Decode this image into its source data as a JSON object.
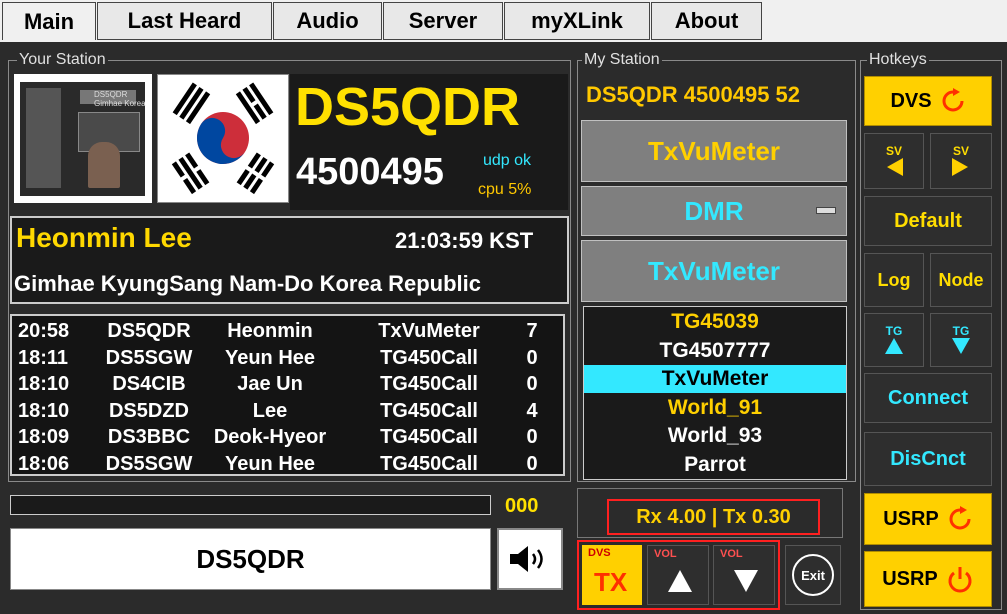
{
  "tabs": [
    {
      "label": "Main"
    },
    {
      "label": "Last Heard"
    },
    {
      "label": "Audio"
    },
    {
      "label": "Server"
    },
    {
      "label": "myXLink"
    },
    {
      "label": "About"
    }
  ],
  "your_station": {
    "group_label": "Your Station",
    "photo_caption": "DS5QDR Gimhae Korea",
    "callsign": "DS5QDR",
    "dmr_id": "4500495",
    "udp_status": "udp ok",
    "cpu": "cpu  5%",
    "name": "Heonmin Lee",
    "time": "21:03:59 KST",
    "location": "Gimhae KyungSang Nam-Do Korea Republic"
  },
  "last_heard": [
    {
      "time": "20:58",
      "call": "DS5QDR",
      "name": "Heonmin",
      "tg": "TxVuMeter",
      "dur": "7"
    },
    {
      "time": "18:11",
      "call": "DS5SGW",
      "name": "Yeun Hee",
      "tg": "TG450Call",
      "dur": "0"
    },
    {
      "time": "18:10",
      "call": "DS4CIB",
      "name": "Jae Un",
      "tg": "TG450Call",
      "dur": "0"
    },
    {
      "time": "18:10",
      "call": "DS5DZD",
      "name": "Lee",
      "tg": "TG450Call",
      "dur": "4"
    },
    {
      "time": "18:09",
      "call": "DS3BBC",
      "name": "Deok-Hyeor",
      "tg": "TG450Call",
      "dur": "0"
    },
    {
      "time": "18:06",
      "call": "DS5SGW",
      "name": "Yeun Hee",
      "tg": "TG450Call",
      "dur": "0"
    }
  ],
  "progress": {
    "value": "000",
    "fill": 0
  },
  "bottom_callsign": "DS5QDR",
  "my_station": {
    "group_label": "My Station",
    "header": "DS5QDR 4500495 52",
    "btn_top": "TxVuMeter",
    "mode": "DMR",
    "btn_tg": "TxVuMeter",
    "tg_list": [
      {
        "label": "TG45039",
        "color": "#ffd000",
        "selected": false
      },
      {
        "label": "TG4507777",
        "color": "#ffffff",
        "selected": false
      },
      {
        "label": "TxVuMeter",
        "color": "#000000",
        "selected": true
      },
      {
        "label": "World_91",
        "color": "#ffd000",
        "selected": false
      },
      {
        "label": "World_93",
        "color": "#ffffff",
        "selected": false
      },
      {
        "label": "Parrot",
        "color": "#ffffff",
        "selected": false
      }
    ],
    "rxtx": "Rx 4.00 | Tx 0.30",
    "dvs_small": "DVS",
    "tx_label": "TX",
    "vol_label": "VOL",
    "exit_label": "Exit"
  },
  "hotkeys": {
    "group_label": "Hotkeys",
    "dvs": "DVS",
    "sv": "SV",
    "default": "Default",
    "log": "Log",
    "node": "Node",
    "tg": "TG",
    "connect": "Connect",
    "disconnect": "DisCnct",
    "usrp": "USRP"
  },
  "colors": {
    "accent_yellow": "#ffe000",
    "cyan": "#33e8ff",
    "highlight": "#ff2020"
  }
}
